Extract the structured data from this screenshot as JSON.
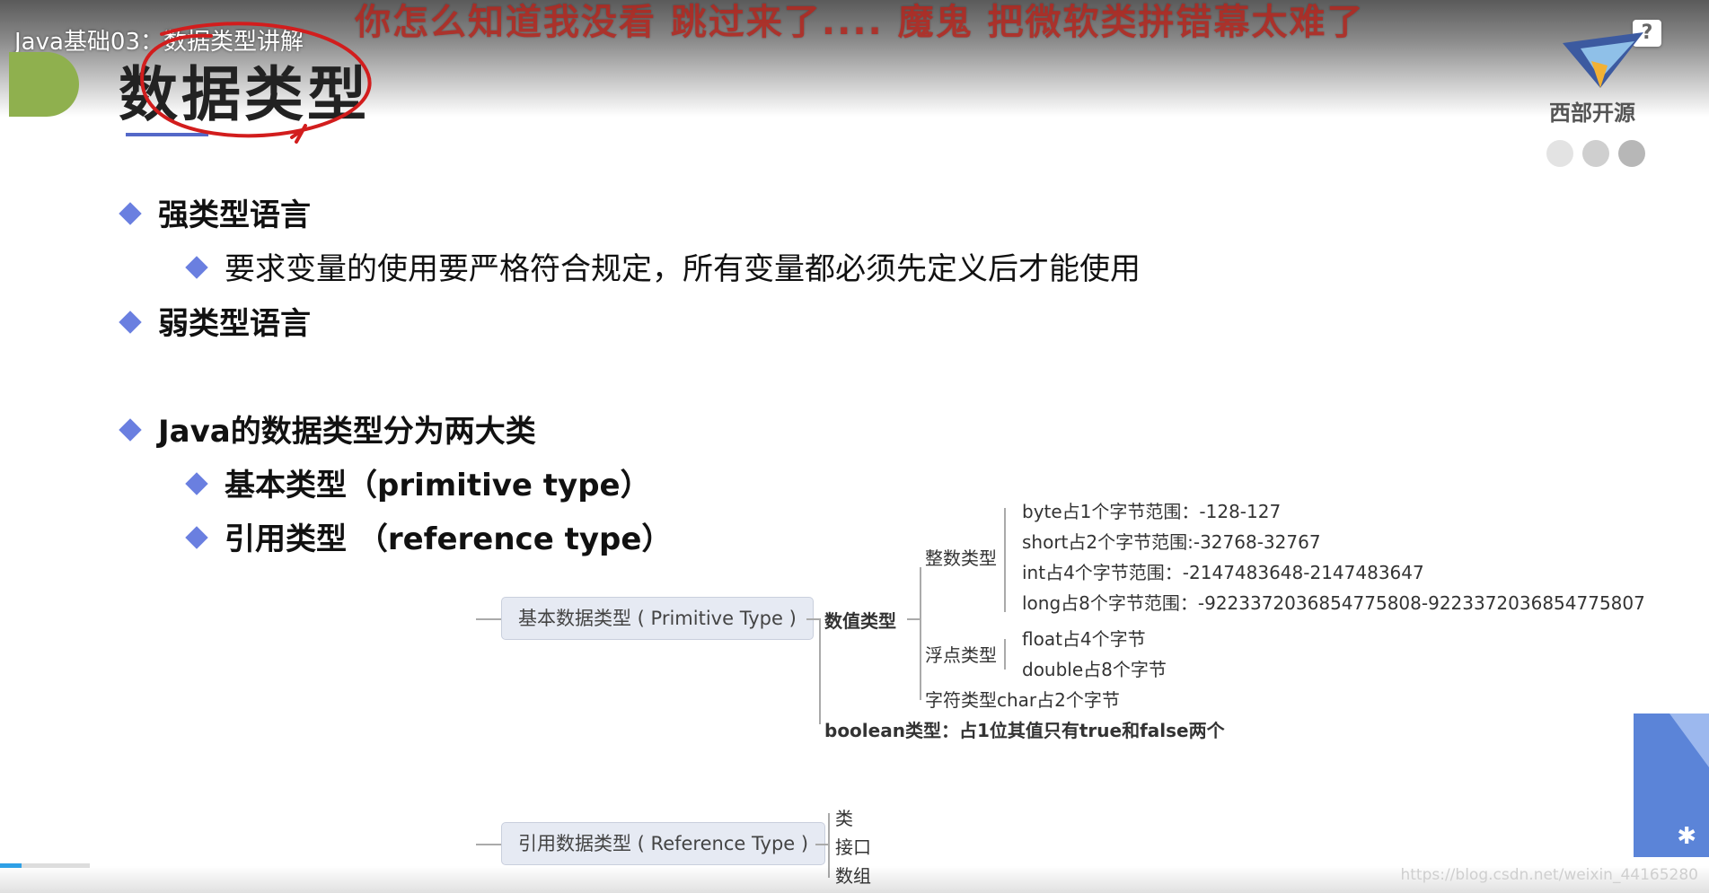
{
  "video": {
    "title": "Java基础03：数据类型讲解",
    "danmaku": "你怎么知道我没看    跳过来了....    魔鬼  把微软类拼错幕太难了",
    "help_label": "?",
    "watermark_url": "https://blog.csdn.net/weixin_44165280",
    "progress_fraction": 0.24
  },
  "slide": {
    "title": "数据类型",
    "logo_text": "西部开源",
    "bullets": [
      {
        "text": "强类型语言"
      },
      {
        "text": "要求变量的使用要严格符合规定，所有变量都必须先定义后才能使用"
      },
      {
        "text": "弱类型语言"
      },
      {
        "text": "Java的数据类型分为两大类"
      },
      {
        "text": "基本类型（primitive type）"
      },
      {
        "text": "引用类型 （reference type）"
      }
    ],
    "mindmap": {
      "primitive": "基本数据类型 ( Primitive Type )",
      "numeric": "数值类型",
      "integer": "整数类型",
      "byte": "byte占1个字节范围：-128-127",
      "short": "short占2个字节范围:-32768-32767",
      "int": "int占4个字节范围：-2147483648-2147483647",
      "long": "long占8个字节范围：-9223372036854775808-9223372036854775807",
      "floating": "浮点类型",
      "float": "float占4个字节",
      "double": "double占8个字节",
      "char": "字符类型char占2个字节",
      "boolean": "boolean类型：占1位其值只有true和false两个",
      "reference": "引用数据类型 ( Reference Type )",
      "class": "类",
      "interface": "接口",
      "array": "数组"
    }
  },
  "colors": {
    "accent": "#6a7fe0",
    "green": "#8fb04e",
    "annotation_red": "#d21d1d",
    "progress": "#2ea0e6"
  }
}
